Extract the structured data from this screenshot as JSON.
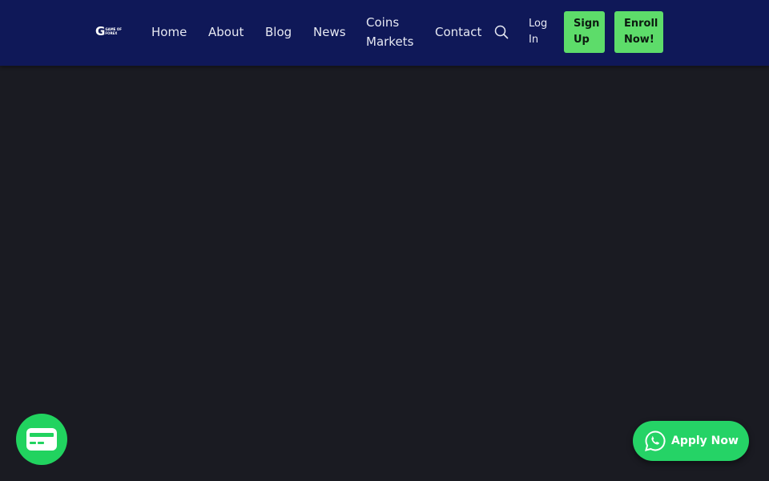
{
  "brand": {
    "mark": "G",
    "lines": [
      "GAME OF",
      "FOREX"
    ]
  },
  "nav": {
    "home": "Home",
    "about": "About",
    "blog": "Blog",
    "news": "News",
    "coins_line1": "Coins",
    "coins_line2": "Markets",
    "contact": "Contact"
  },
  "auth": {
    "login_line1": "Log",
    "login_line2": "In",
    "signup_line1": "Sign",
    "signup_line2": "Up",
    "enroll_line1": "Enroll",
    "enroll_line2": "Now!"
  },
  "floating": {
    "apply_label": "Apply Now"
  },
  "icons": {
    "search": "search-icon",
    "chat": "chat-widget-icon",
    "whatsapp": "whatsapp-icon"
  },
  "colors": {
    "nav_bg": "#0f1858",
    "page_bg": "#1a1b22",
    "accent_green": "#5ddc6a",
    "whatsapp_green": "#25d366"
  }
}
